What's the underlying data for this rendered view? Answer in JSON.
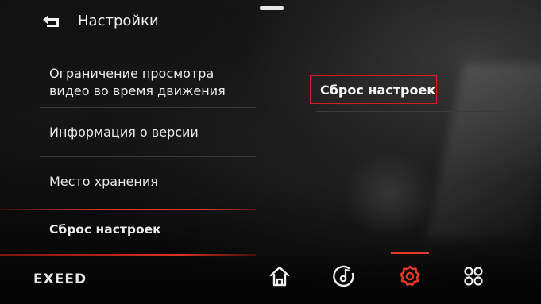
{
  "header": {
    "title": "Настройки",
    "back_icon": "back-arrow-icon"
  },
  "menu": {
    "items": [
      {
        "label_line1": "Ограничение просмотра",
        "label_line2": "видео во время движения",
        "active": false
      },
      {
        "label": "Информация о версии",
        "active": false
      },
      {
        "label": "Место хранения",
        "active": false
      },
      {
        "label": "Сброс настроек",
        "active": true
      }
    ]
  },
  "detail": {
    "selected_option": "Сброс настроек"
  },
  "bottom_bar": {
    "brand": "EXEED",
    "nav": [
      {
        "icon": "home-icon",
        "active": false
      },
      {
        "icon": "music-icon",
        "active": false
      },
      {
        "icon": "settings-gear-icon",
        "active": true
      },
      {
        "icon": "apps-grid-icon",
        "active": false
      }
    ]
  },
  "colors": {
    "accent": "#e23a2a",
    "text": "#eaeaea",
    "background": "#070707"
  }
}
